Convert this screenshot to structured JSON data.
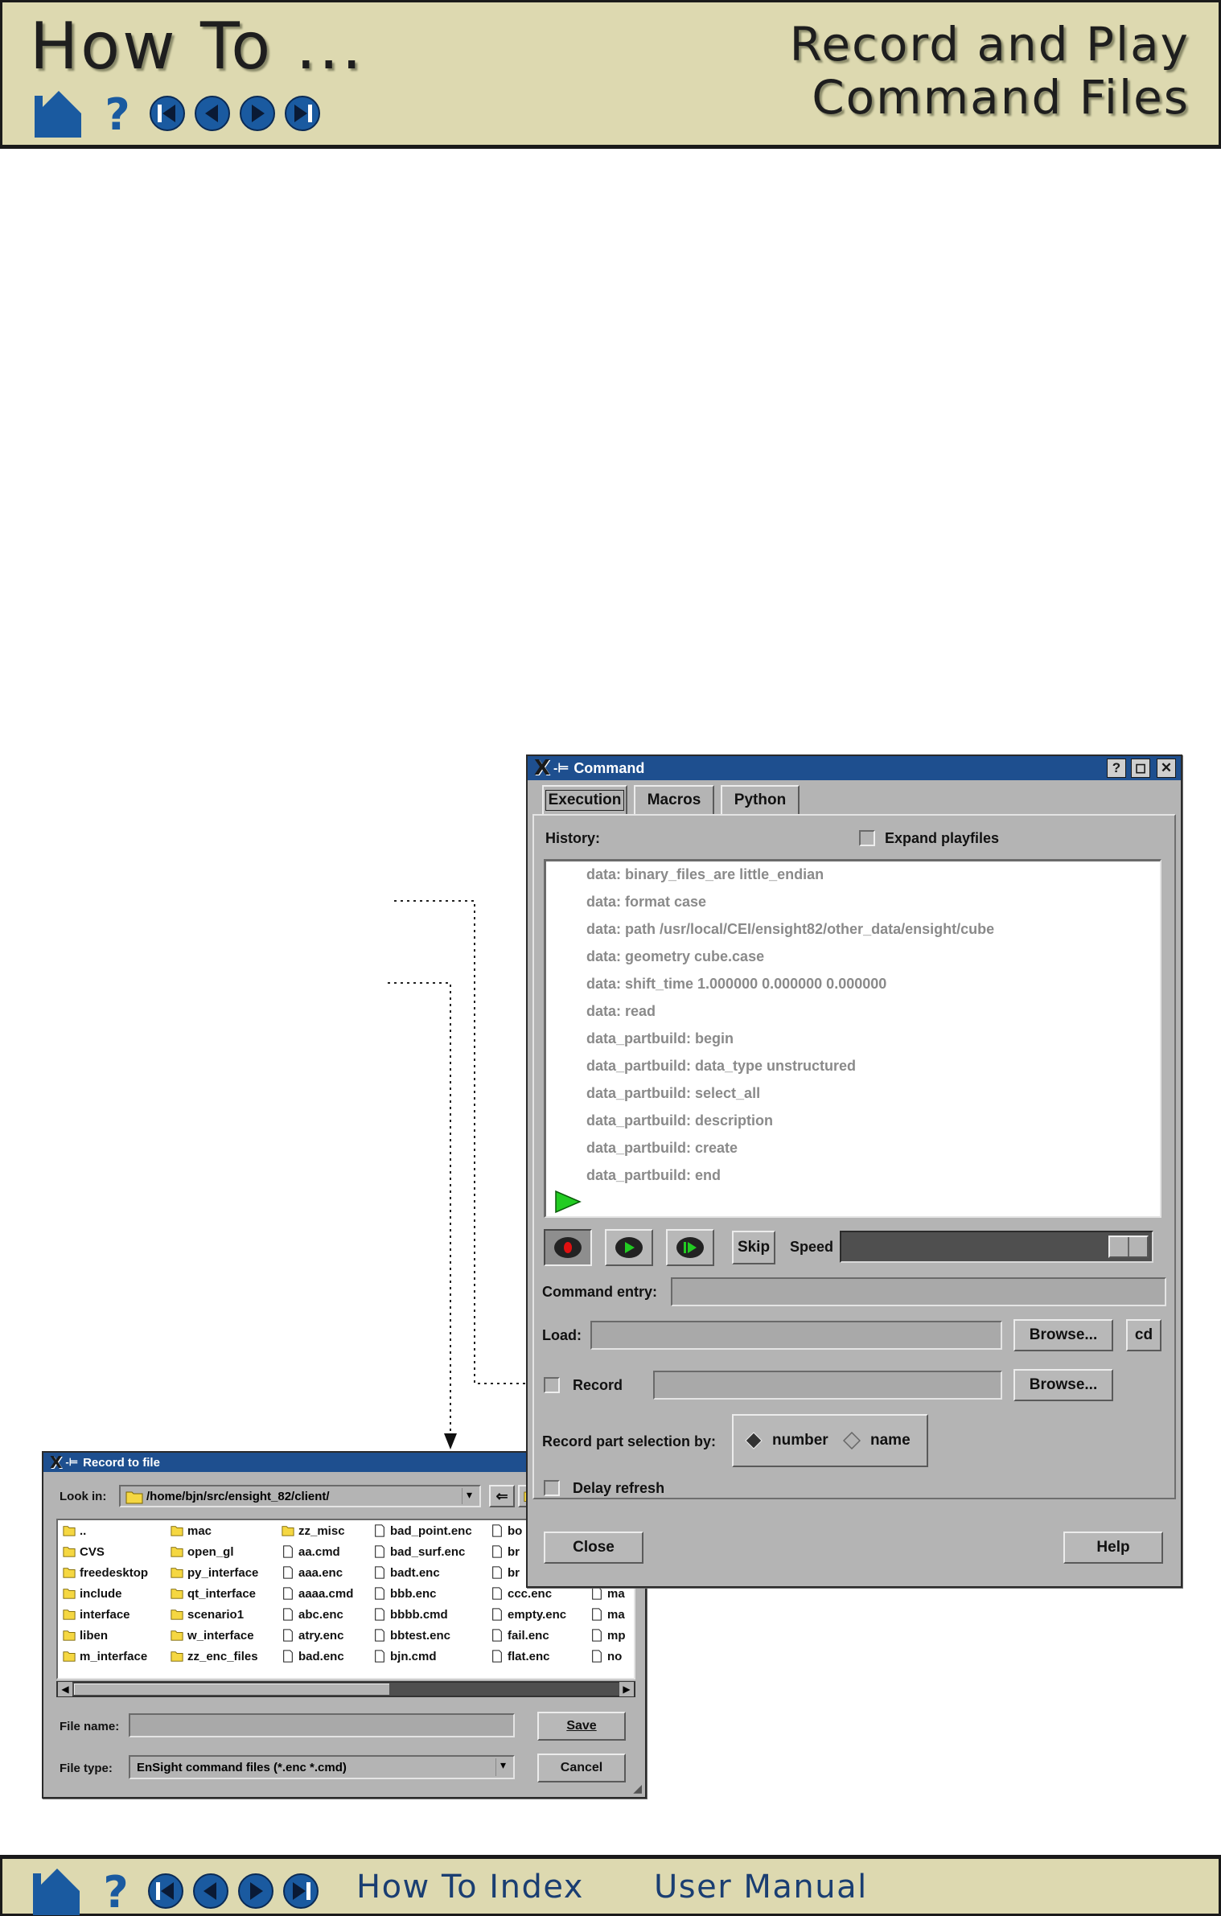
{
  "header": {
    "title": "How To ...",
    "topic_line1": "Record and Play",
    "topic_line2": "Command Files"
  },
  "footer": {
    "index_link": "How To Index",
    "manual_link": "User Manual"
  },
  "command_dialog": {
    "title": "Command",
    "window_controls": [
      "?",
      "◻",
      "✕"
    ],
    "tabs": [
      {
        "label": "Execution",
        "active": true
      },
      {
        "label": "Macros",
        "active": false
      },
      {
        "label": "Python",
        "active": false
      }
    ],
    "history_label": "History:",
    "expand_playfiles_label": "Expand playfiles",
    "history": [
      "data: binary_files_are little_endian",
      "data: format case",
      "data: path /usr/local/CEI/ensight82/other_data/ensight/cube",
      "data: geometry cube.case",
      "data: shift_time 1.000000 0.000000 0.000000",
      "data: read",
      "data_partbuild: begin",
      "data_partbuild: data_type unstructured",
      "data_partbuild: select_all",
      "data_partbuild: description",
      "data_partbuild: create",
      "data_partbuild: end"
    ],
    "skip_label": "Skip",
    "speed_label": "Speed",
    "speed_level": 1.0,
    "command_entry_label": "Command entry:",
    "command_entry_value": "",
    "load_label": "Load:",
    "load_value": "",
    "browse_label": "Browse...",
    "cd_label": "cd",
    "record_label": "Record",
    "record_value": "",
    "record_part_label": "Record part selection by:",
    "radio_options": [
      {
        "label": "number",
        "selected": true
      },
      {
        "label": "name",
        "selected": false
      }
    ],
    "delay_refresh_label": "Delay refresh",
    "close_label": "Close",
    "help_label": "Help"
  },
  "record_dialog": {
    "title": "Record to file",
    "look_in_label": "Look in:",
    "look_in_value": "/home/bjn/src/ensight_82/client/",
    "columns": [
      [
        {
          "name": "..",
          "type": "folder"
        },
        {
          "name": "CVS",
          "type": "folder"
        },
        {
          "name": "freedesktop",
          "type": "folder"
        },
        {
          "name": "include",
          "type": "folder"
        },
        {
          "name": "interface",
          "type": "folder"
        },
        {
          "name": "liben",
          "type": "folder"
        },
        {
          "name": "m_interface",
          "type": "folder"
        }
      ],
      [
        {
          "name": "mac",
          "type": "folder"
        },
        {
          "name": "open_gl",
          "type": "folder"
        },
        {
          "name": "py_interface",
          "type": "folder"
        },
        {
          "name": "qt_interface",
          "type": "folder"
        },
        {
          "name": "scenario1",
          "type": "folder"
        },
        {
          "name": "w_interface",
          "type": "folder"
        },
        {
          "name": "zz_enc_files",
          "type": "folder"
        }
      ],
      [
        {
          "name": "zz_misc",
          "type": "folder"
        },
        {
          "name": "aa.cmd",
          "type": "file"
        },
        {
          "name": "aaa.enc",
          "type": "file"
        },
        {
          "name": "aaaa.cmd",
          "type": "file"
        },
        {
          "name": "abc.enc",
          "type": "file"
        },
        {
          "name": "atry.enc",
          "type": "file"
        },
        {
          "name": "bad.enc",
          "type": "file"
        }
      ],
      [
        {
          "name": "bad_point.enc",
          "type": "file"
        },
        {
          "name": "bad_surf.enc",
          "type": "file"
        },
        {
          "name": "badt.enc",
          "type": "file"
        },
        {
          "name": "bbb.enc",
          "type": "file"
        },
        {
          "name": "bbbb.cmd",
          "type": "file"
        },
        {
          "name": "bbtest.enc",
          "type": "file"
        },
        {
          "name": "bjn.cmd",
          "type": "file"
        }
      ],
      [
        {
          "name": "bo",
          "type": "file"
        },
        {
          "name": "br",
          "type": "file"
        },
        {
          "name": "br",
          "type": "file"
        },
        {
          "name": "ccc.enc",
          "type": "file"
        },
        {
          "name": "empty.enc",
          "type": "file"
        },
        {
          "name": "fail.enc",
          "type": "file"
        },
        {
          "name": "flat.enc",
          "type": "file"
        }
      ],
      [
        {
          "name": "",
          "type": "file"
        },
        {
          "name": "",
          "type": "file"
        },
        {
          "name": "",
          "type": "file"
        },
        {
          "name": "ma",
          "type": "file"
        },
        {
          "name": "ma",
          "type": "file"
        },
        {
          "name": "mp",
          "type": "file"
        },
        {
          "name": "no",
          "type": "file"
        }
      ]
    ],
    "file_name_label": "File name:",
    "file_name_value": "",
    "file_type_label": "File type:",
    "file_type_value": "EnSight command files (*.enc *.cmd)",
    "save_label": "Save",
    "cancel_label": "Cancel"
  },
  "colors": {
    "banner": "#ddd9b0",
    "nav_blue": "#1a5aa0",
    "titlebar": "#1e4f8f",
    "dialog_gray": "#b4b4b4",
    "folder_yellow": "#f5d742",
    "play_green": "#22cc22",
    "record_red": "#e01010"
  }
}
